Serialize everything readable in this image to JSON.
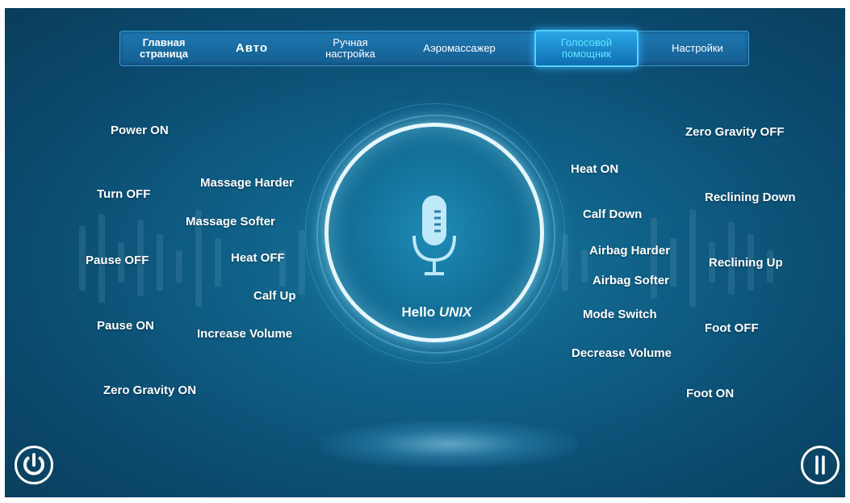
{
  "nav": {
    "tabs": [
      {
        "label": "Главная страница",
        "line1": "Главная",
        "line2": "страница"
      },
      {
        "label": "Авто"
      },
      {
        "label": "Ручная настройка",
        "line1": "Ручная",
        "line2": "настройка"
      },
      {
        "label": "Аэромассажер"
      },
      {
        "label": "Голосовой помощник",
        "line1": "Голосовой",
        "line2": "помощник",
        "active": true
      },
      {
        "label": "Настройки"
      }
    ]
  },
  "center": {
    "hello_prefix": "Hello",
    "hello_brand": "UNIX"
  },
  "commands": {
    "left_outer": [
      "Power  ON",
      "Turn OFF",
      "Pause OFF",
      "Pause ON",
      "Zero Gravity ON"
    ],
    "left_inner": [
      "Massage Harder",
      "Massage Softer",
      "Heat OFF",
      "Calf Up",
      "Increase Volume"
    ],
    "right_inner": [
      "Heat ON",
      "Calf Down",
      "Airbag Harder",
      "Airbag Softer",
      "Mode Switch",
      "Decrease Volume"
    ],
    "right_outer": [
      "Zero Gravity OFF",
      "Reclining Down",
      "Reclining Up",
      "Foot OFF",
      "Foot ON"
    ]
  },
  "controls": {
    "power_icon": "power-icon",
    "pause_icon": "pause-icon"
  },
  "colors": {
    "background": "#0f5f86",
    "nav_bar": "#1d78b0",
    "active_tab_text": "#5fe6ff",
    "text": "#ffffff"
  }
}
